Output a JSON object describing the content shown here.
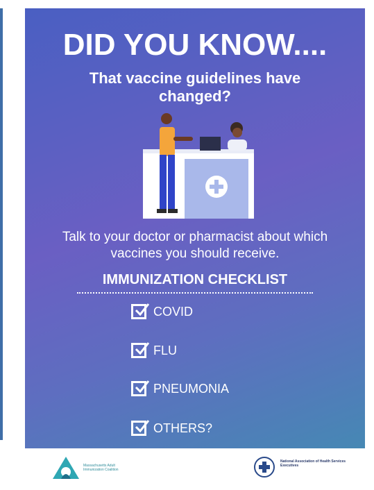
{
  "poster": {
    "headline": "DID YOU KNOW....",
    "subhead": "That vaccine guidelines have changed?",
    "talk_text": "Talk to your doctor or pharmacist about which vaccines you should receive.",
    "checklist_title": "IMMUNIZATION CHECKLIST",
    "checklist": [
      {
        "label": "COVID",
        "checked": true
      },
      {
        "label": "FLU",
        "checked": true
      },
      {
        "label": "PNEUMONIA",
        "checked": true
      },
      {
        "label": "OTHERS?",
        "checked": true
      }
    ]
  },
  "footer": {
    "left_logo_text": "Massachusetts Adult Immunization Coalition",
    "right_logo_text": "National Association of Health Services Executives"
  },
  "colors": {
    "accent_blue": "#3f6ea8",
    "gradient_purple": "#6a5fc3",
    "gradient_teal": "#4688b4",
    "check": "#ffffff"
  }
}
